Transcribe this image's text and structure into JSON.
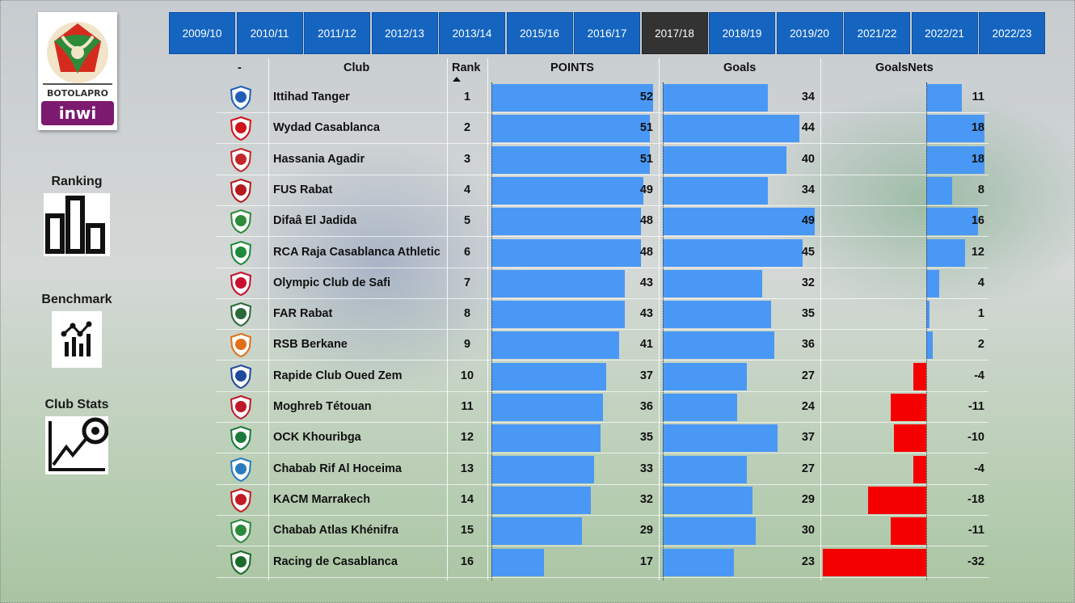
{
  "sidebar": {
    "logo_text": "BOTOLA PRO inwi",
    "items": [
      {
        "label": "Ranking",
        "icon": "bar-chart-icon"
      },
      {
        "label": "Benchmark",
        "icon": "line-bar-chart-icon"
      },
      {
        "label": "Club Stats",
        "icon": "trend-ball-icon"
      }
    ]
  },
  "seasons": {
    "items": [
      "2009/10",
      "2010/11",
      "2011/12",
      "2012/13",
      "2013/14",
      "2015/16",
      "2016/17",
      "2017/18",
      "2018/19",
      "2019/20",
      "2021/22",
      "2022/21",
      "2022/23"
    ],
    "selected": "2017/18"
  },
  "table": {
    "headers": {
      "logo": "-",
      "club": "Club",
      "rank": "Rank",
      "points": "POINTS",
      "goals": "Goals",
      "goals_net": "GoalsNets"
    },
    "sort_column": "rank",
    "colors": {
      "positive": "#4a98f5",
      "negative": "#f40000"
    },
    "rows": [
      {
        "club": "Ittihad Tanger",
        "rank": 1,
        "points": 52,
        "goals": 34,
        "goals_net": 11,
        "logo_color": "#1e5fb5"
      },
      {
        "club": "Wydad Casablanca",
        "rank": 2,
        "points": 51,
        "goals": 44,
        "goals_net": 18,
        "logo_color": "#d0141b"
      },
      {
        "club": "Hassania Agadir",
        "rank": 3,
        "points": 51,
        "goals": 40,
        "goals_net": 18,
        "logo_color": "#c2262b"
      },
      {
        "club": "FUS Rabat",
        "rank": 4,
        "points": 49,
        "goals": 34,
        "goals_net": 8,
        "logo_color": "#b51a1f"
      },
      {
        "club": "Difaâ El Jadida",
        "rank": 5,
        "points": 48,
        "goals": 49,
        "goals_net": 16,
        "logo_color": "#2e8b3a"
      },
      {
        "club": "RCA Raja Casablanca Athletic",
        "rank": 6,
        "points": 48,
        "goals": 45,
        "goals_net": 12,
        "logo_color": "#1f8a3b"
      },
      {
        "club": "Olympic Club de Safi",
        "rank": 7,
        "points": 43,
        "goals": 32,
        "goals_net": 4,
        "logo_color": "#c8102e"
      },
      {
        "club": "FAR Rabat",
        "rank": 8,
        "points": 43,
        "goals": 35,
        "goals_net": 1,
        "logo_color": "#2a6a3a"
      },
      {
        "club": "RSB Berkane",
        "rank": 9,
        "points": 41,
        "goals": 36,
        "goals_net": 2,
        "logo_color": "#e0701a"
      },
      {
        "club": "Rapide Club Oued Zem",
        "rank": 10,
        "points": 37,
        "goals": 27,
        "goals_net": -4,
        "logo_color": "#1e4aa0"
      },
      {
        "club": "Moghreb Tétouan",
        "rank": 11,
        "points": 36,
        "goals": 24,
        "goals_net": -11,
        "logo_color": "#c0182a"
      },
      {
        "club": "OCK Khouribga",
        "rank": 12,
        "points": 35,
        "goals": 37,
        "goals_net": -10,
        "logo_color": "#1b7a3b"
      },
      {
        "club": "Chabab Rif Al Hoceima",
        "rank": 13,
        "points": 33,
        "goals": 27,
        "goals_net": -4,
        "logo_color": "#2a7ac0"
      },
      {
        "club": "KACM Marrakech",
        "rank": 14,
        "points": 32,
        "goals": 29,
        "goals_net": -18,
        "logo_color": "#c21a22"
      },
      {
        "club": "Chabab Atlas Khénifra",
        "rank": 15,
        "points": 29,
        "goals": 30,
        "goals_net": -11,
        "logo_color": "#2c8a3c"
      },
      {
        "club": "Racing de Casablanca",
        "rank": 16,
        "points": 17,
        "goals": 23,
        "goals_net": -32,
        "logo_color": "#1a6a2a"
      }
    ]
  }
}
